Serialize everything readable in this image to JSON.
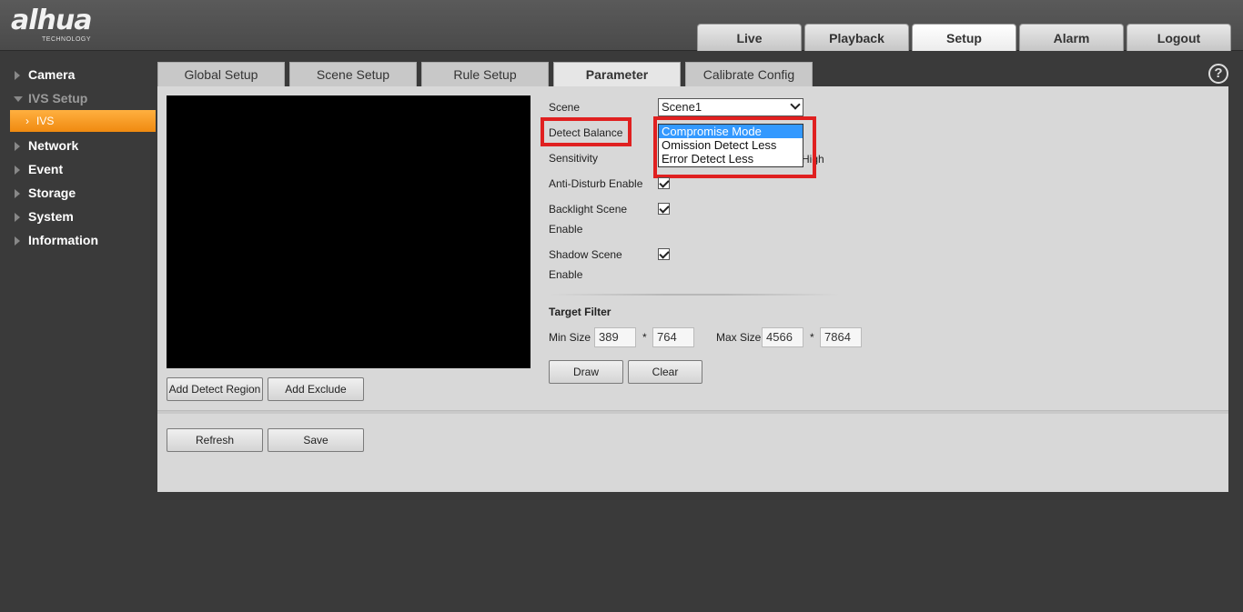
{
  "brand": {
    "logo_text": "alhua",
    "logo_sub": "TECHNOLOGY"
  },
  "topnav": [
    {
      "label": "Live"
    },
    {
      "label": "Playback"
    },
    {
      "label": "Setup"
    },
    {
      "label": "Alarm"
    },
    {
      "label": "Logout"
    }
  ],
  "sidebar": {
    "items": [
      {
        "label": "Camera"
      },
      {
        "label": "IVS Setup"
      },
      {
        "label": "IVS"
      },
      {
        "label": "Network"
      },
      {
        "label": "Event"
      },
      {
        "label": "Storage"
      },
      {
        "label": "System"
      },
      {
        "label": "Information"
      }
    ]
  },
  "subtabs": [
    {
      "label": "Global Setup"
    },
    {
      "label": "Scene Setup"
    },
    {
      "label": "Rule Setup"
    },
    {
      "label": "Parameter"
    },
    {
      "label": "Calibrate Config"
    }
  ],
  "help": {
    "label": "?"
  },
  "left_buttons": {
    "add_detect_region": "Add Detect Region",
    "add_exclude": "Add Exclude"
  },
  "form": {
    "scene_label": "Scene",
    "scene_value": "Scene1",
    "detect_balance_label": "Detect Balance",
    "detect_balance_options": [
      "Compromise Mode",
      "Omission Detect Less",
      "Error Detect Less"
    ],
    "sensitivity_label": "Sensitivity",
    "sensitivity_high": "High",
    "anti_disturb_label": "Anti-Disturb Enable",
    "backlight_label_1": "Backlight Scene",
    "backlight_label_2": "Enable",
    "shadow_label_1": "Shadow Scene",
    "shadow_label_2": "Enable",
    "target_filter_label": "Target Filter",
    "min_size_label": "Min Size",
    "min_w": "389",
    "min_h": "764",
    "max_size_label": "Max Size",
    "max_w": "4566",
    "max_h": "7864",
    "times": "*",
    "draw_label": "Draw",
    "clear_label": "Clear"
  },
  "bottom_buttons": {
    "refresh": "Refresh",
    "save": "Save"
  },
  "colors": {
    "highlight_red": "#e02020",
    "active_orange": "#f08a10",
    "dropdown_select": "#3399ff"
  }
}
